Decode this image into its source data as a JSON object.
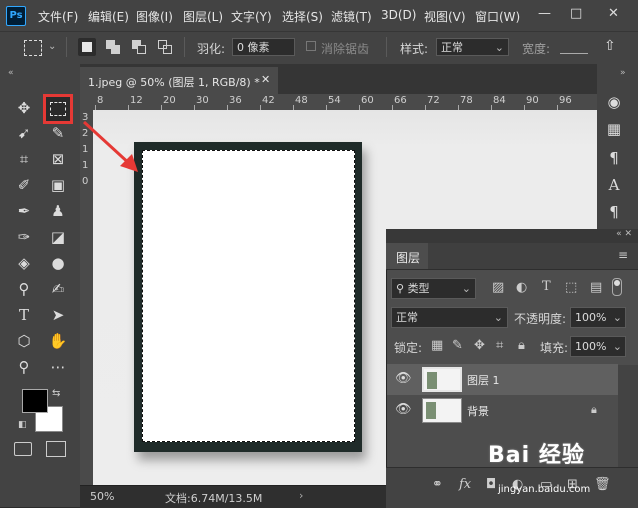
{
  "app": {
    "logo": "Ps"
  },
  "menu": [
    "文件(F)",
    "编辑(E)",
    "图像(I)",
    "图层(L)",
    "文字(Y)",
    "选择(S)",
    "滤镜(T)",
    "3D(D)",
    "视图(V)",
    "窗口(W)"
  ],
  "window_controls": [
    "—",
    "□",
    "✕"
  ],
  "options": {
    "feather_label": "羽化:",
    "feather_value": "0 像素",
    "antialias_label": "消除锯齿",
    "style_label": "样式:",
    "style_value": "正常",
    "width_label": "宽度:"
  },
  "document": {
    "tab_title": "1.jpeg @ 50% (图层 1, RGB/8) *"
  },
  "rulers": {
    "h_ticks": [
      "8",
      "12",
      "20",
      "30",
      "36",
      "42",
      "48",
      "54",
      "60",
      "66",
      "72",
      "78",
      "84",
      "90",
      "96"
    ],
    "v_ticks": [
      "3",
      "2",
      "1",
      "1",
      "0"
    ]
  },
  "status": {
    "zoom": "50%",
    "doc_info": "文档:6.74M/13.5M"
  },
  "layers_panel": {
    "title": "图层",
    "filter_kind": "类型",
    "blend_mode": "正常",
    "opacity_label": "不透明度:",
    "opacity_value": "100%",
    "lock_label": "锁定:",
    "fill_label": "填充:",
    "fill_value": "100%",
    "layers": [
      {
        "name": "图层 1",
        "selected": true
      },
      {
        "name": "背景",
        "selected": false,
        "locked": true
      }
    ]
  },
  "watermark": {
    "brand": "Bai 经验",
    "url": "jingyan.baidu.com"
  },
  "colors": {
    "highlight_box": "#e53935",
    "arrow": "#e53935",
    "frame": "#1f2b29",
    "selected_layer": "#606060"
  }
}
